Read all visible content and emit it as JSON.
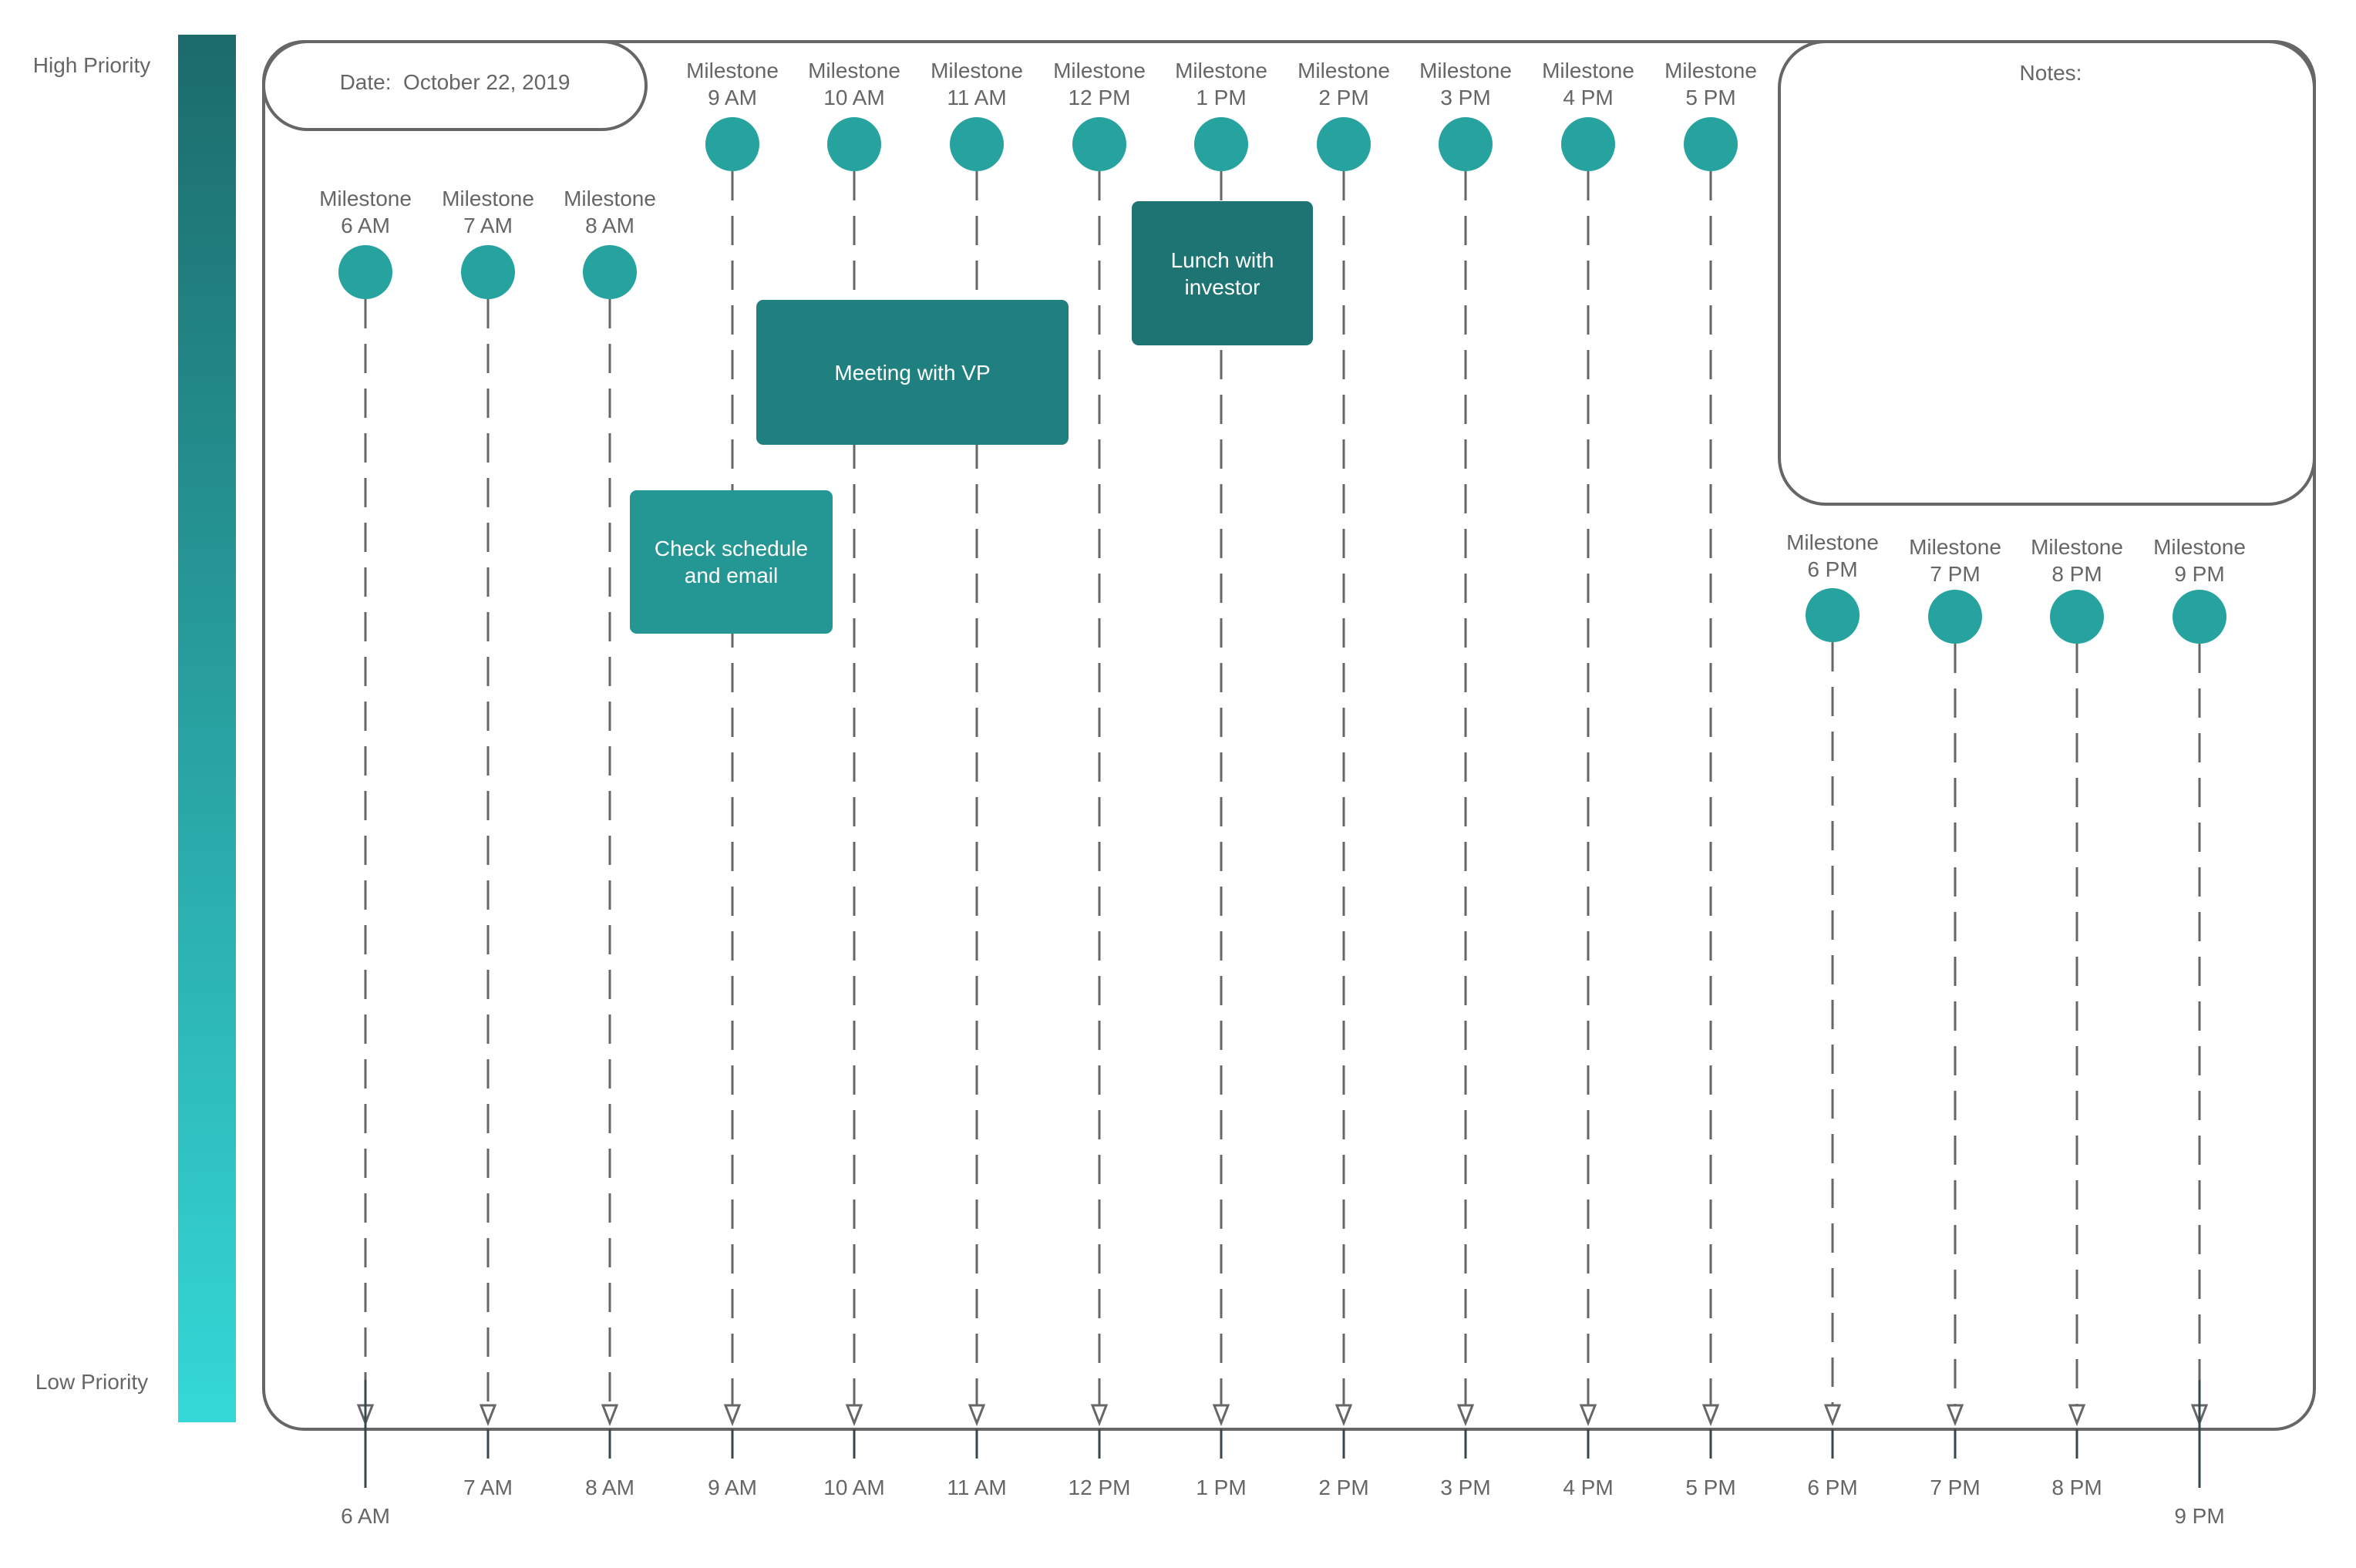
{
  "colors": {
    "priority_high": "#1c6b6b",
    "priority_low": "#35d8d8",
    "milestone": "#26a29f",
    "frame_stroke": "#666666",
    "tick_stroke": "#37474f",
    "text": "#666666"
  },
  "priority_scale": {
    "high_label": "High Priority",
    "low_label": "Low Priority"
  },
  "header": {
    "date_label": "Date:  October 22, 2019"
  },
  "notes": {
    "title": "Notes:",
    "content": ""
  },
  "timeline": {
    "hours": [
      "6 AM",
      "7 AM",
      "8 AM",
      "9 AM",
      "10 AM",
      "11 AM",
      "12 PM",
      "1 PM",
      "2 PM",
      "3 PM",
      "4 PM",
      "5 PM",
      "6 PM",
      "7 PM",
      "8 PM",
      "9 PM"
    ],
    "milestones": [
      {
        "title": "Milestone",
        "time": "6 AM"
      },
      {
        "title": "Milestone",
        "time": "7 AM"
      },
      {
        "title": "Milestone",
        "time": "8 AM"
      },
      {
        "title": "Milestone",
        "time": "9 AM"
      },
      {
        "title": "Milestone",
        "time": "10 AM"
      },
      {
        "title": "Milestone",
        "time": "11 AM"
      },
      {
        "title": "Milestone",
        "time": "12 PM"
      },
      {
        "title": "Milestone",
        "time": "1 PM"
      },
      {
        "title": "Milestone",
        "time": "2 PM"
      },
      {
        "title": "Milestone",
        "time": "3 PM"
      },
      {
        "title": "Milestone",
        "time": "4 PM"
      },
      {
        "title": "Milestone",
        "time": "5 PM"
      },
      {
        "title": "Milestone",
        "time": "6 PM"
      },
      {
        "title": "Milestone",
        "time": "7 PM"
      },
      {
        "title": "Milestone",
        "time": "8 PM"
      },
      {
        "title": "Milestone",
        "time": "9 PM"
      }
    ],
    "tasks": [
      {
        "label": "Check schedule and email",
        "start": "9 AM",
        "priority": "medium",
        "color": "#249694"
      },
      {
        "label": "Meeting with VP",
        "start": "10 AM",
        "end": "11 AM",
        "priority": "high",
        "color": "#1f807f"
      },
      {
        "label": "Lunch with investor",
        "start": "1 PM",
        "priority": "highest",
        "color": "#1e7473"
      }
    ]
  }
}
